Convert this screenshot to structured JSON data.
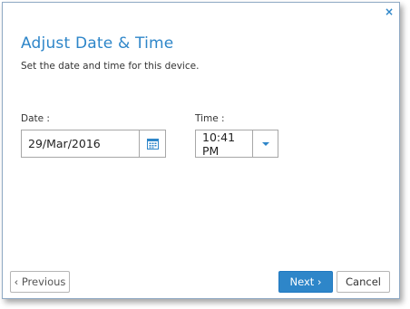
{
  "dialog": {
    "close_glyph": "×",
    "title": "Adjust Date & Time",
    "subtitle": "Set the date and time for this device."
  },
  "date_field": {
    "label": "Date :",
    "value": "29/Mar/2016",
    "icon": "calendar-icon"
  },
  "time_field": {
    "label": "Time :",
    "value": "10:41 PM",
    "icon": "caret-down-icon"
  },
  "buttons": {
    "previous": "‹ Previous",
    "next": "Next ›",
    "cancel": "Cancel"
  },
  "colors": {
    "accent": "#2e86c9",
    "border": "#a7a7a7"
  }
}
